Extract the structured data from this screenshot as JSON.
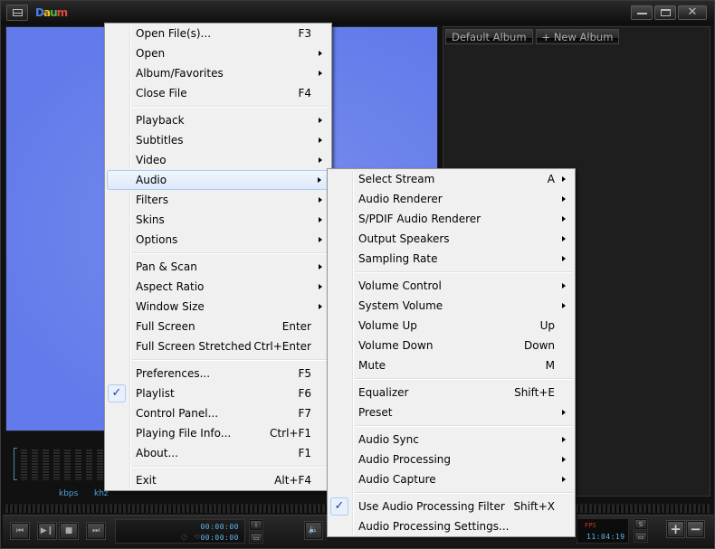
{
  "titlebar": {
    "logo": {
      "d": "D",
      "a": "a",
      "u": "u",
      "m": "m"
    },
    "menu_icon": "menu-icon",
    "controls": {
      "minimize": "minimize-icon",
      "maximize": "maximize-icon",
      "close_label": "✕"
    }
  },
  "playlist": {
    "tabs": [
      {
        "label": "Default Album"
      },
      {
        "label": "+ New Album"
      }
    ]
  },
  "info_strip": {
    "kbps": "kbps",
    "khz": "khz"
  },
  "controls": {
    "prev": "⏮",
    "play_pause": "▶❙",
    "stop": "■",
    "next": "⏭",
    "time_elapsed": "00:00:00",
    "time_total": "00:00:00",
    "info_btn": "i",
    "screen_btn": "▭",
    "volume_icon": "🔈",
    "fps_label": "FPS",
    "clock": "11:04:19",
    "s_btn": "S",
    "o_btn": "▭",
    "zoom_in": "+",
    "zoom_out": "−"
  },
  "main_menu": {
    "groups": [
      [
        {
          "label": "Open File(s)...",
          "shortcut": "F3"
        },
        {
          "label": "Open",
          "submenu": true
        },
        {
          "label": "Album/Favorites",
          "submenu": true
        },
        {
          "label": "Close File",
          "shortcut": "F4"
        }
      ],
      [
        {
          "label": "Playback",
          "submenu": true
        },
        {
          "label": "Subtitles",
          "submenu": true
        },
        {
          "label": "Video",
          "submenu": true
        },
        {
          "label": "Audio",
          "submenu": true,
          "highlighted": true
        },
        {
          "label": "Filters",
          "submenu": true
        },
        {
          "label": "Skins",
          "submenu": true
        },
        {
          "label": "Options",
          "submenu": true
        }
      ],
      [
        {
          "label": "Pan & Scan",
          "submenu": true
        },
        {
          "label": "Aspect Ratio",
          "submenu": true
        },
        {
          "label": "Window Size",
          "submenu": true
        },
        {
          "label": "Full Screen",
          "shortcut": "Enter"
        },
        {
          "label": "Full Screen Stretched",
          "shortcut": "Ctrl+Enter"
        }
      ],
      [
        {
          "label": "Preferences...",
          "shortcut": "F5"
        },
        {
          "label": "Playlist",
          "shortcut": "F6",
          "checked": true
        },
        {
          "label": "Control Panel...",
          "shortcut": "F7"
        },
        {
          "label": "Playing File Info...",
          "shortcut": "Ctrl+F1"
        },
        {
          "label": "About...",
          "shortcut": "F1"
        }
      ],
      [
        {
          "label": "Exit",
          "shortcut": "Alt+F4"
        }
      ]
    ]
  },
  "audio_menu": {
    "groups": [
      [
        {
          "label": "Select Stream",
          "shortcut": "A",
          "submenu": true
        },
        {
          "label": "Audio Renderer",
          "submenu": true
        },
        {
          "label": "S/PDIF Audio Renderer",
          "submenu": true
        },
        {
          "label": "Output Speakers",
          "submenu": true
        },
        {
          "label": "Sampling Rate",
          "submenu": true
        }
      ],
      [
        {
          "label": "Volume Control",
          "submenu": true
        },
        {
          "label": "System Volume",
          "submenu": true
        },
        {
          "label": "Volume Up",
          "shortcut": "Up"
        },
        {
          "label": "Volume Down",
          "shortcut": "Down"
        },
        {
          "label": "Mute",
          "shortcut": "M"
        }
      ],
      [
        {
          "label": "Equalizer",
          "shortcut": "Shift+E"
        },
        {
          "label": "Preset",
          "submenu": true
        }
      ],
      [
        {
          "label": "Audio Sync",
          "submenu": true
        },
        {
          "label": "Audio Processing",
          "submenu": true
        },
        {
          "label": "Audio Capture",
          "submenu": true
        }
      ],
      [
        {
          "label": "Use Audio Processing Filter",
          "shortcut": "Shift+X",
          "checked": true
        },
        {
          "label": "Audio Processing Settings..."
        }
      ]
    ]
  },
  "check_glyph": "✓"
}
